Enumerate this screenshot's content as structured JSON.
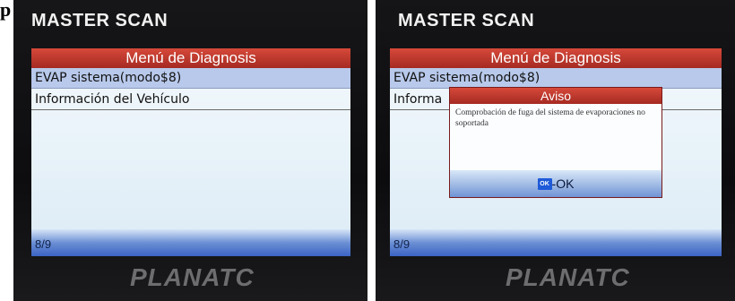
{
  "corner_glyph": "p",
  "photos": [
    {
      "device_brand": "MASTER SCAN",
      "device_logo": "PLANATC",
      "menu_title": "Menú de Diagnosis",
      "menu_items": [
        "EVAP sistema(modo$8)",
        "Información del Vehículo"
      ],
      "selected_index": 0,
      "page_indicator": "8/9"
    },
    {
      "device_brand": "MASTER SCAN",
      "device_logo": "PLANATC",
      "menu_title": "Menú de Diagnosis",
      "menu_items": [
        "EVAP sistema(modo$8)",
        "Informa"
      ],
      "selected_index": 0,
      "page_indicator": "8/9",
      "dialog": {
        "title": "Aviso",
        "message": "Comprobación de fuga del sistema de evaporaciones no soportada",
        "ok_icon_text": "OK",
        "ok_label": "-OK"
      }
    }
  ],
  "colors": {
    "title_bar": "#b8342a",
    "selected_row": "#b8c9eb",
    "ok_icon": "#1f5ad8"
  },
  "icons": [
    "ok-key-icon"
  ]
}
